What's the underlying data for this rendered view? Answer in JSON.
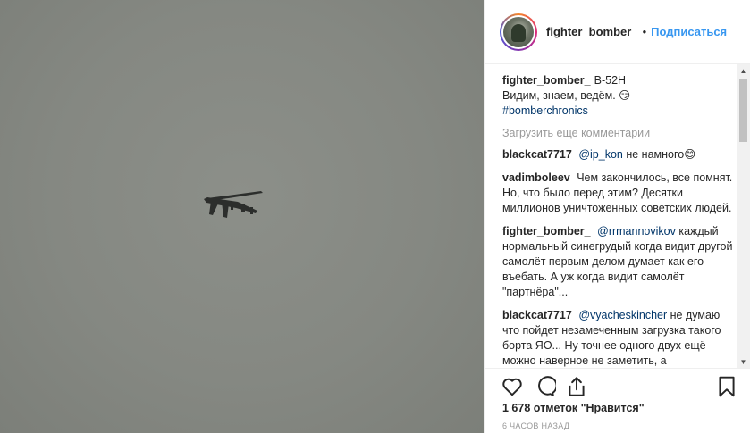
{
  "post": {
    "username": "fighter_bomber_",
    "follow_dot": "•",
    "follow_label": "Подписаться"
  },
  "caption": {
    "user": "fighter_bomber_",
    "line1": "B-52H",
    "line2": "Видим, знаем, ведём. 😏",
    "hashtag": "#bomberchronics"
  },
  "load_more_label": "Загрузить еще комментарии",
  "comments": [
    {
      "user": "blackcat7717",
      "mention": "@ip_kon",
      "text": "не намного😊"
    },
    {
      "user": "vadimboleev",
      "mention": "",
      "text": "Чем закончилось, все помнят. Но, что было перед этим? Десятки миллионов уничтоженных советских людей."
    },
    {
      "user": "fighter_bomber_",
      "mention": "@rrmannovikov",
      "text": "каждый нормальный синегрудый когда видит другой самолёт первым делом думает как его въебать. А уж когда видит самолёт \"партнёра\"..."
    },
    {
      "user": "blackcat7717",
      "mention": "@vyacheskincher",
      "text": "не думаю что пойдет незамеченным загрузка такого борта ЯО... Ну точнее одного двух ещё можно наверное не заметить, а массированно нет...И если не было"
    }
  ],
  "stats": {
    "likes_count": "1 678 отметок",
    "likes_suffix": "\"Нравится\""
  },
  "time_ago": "6 ЧАСОВ НАЗАД",
  "scrollbar": {
    "up": "▲",
    "down": "▼"
  }
}
